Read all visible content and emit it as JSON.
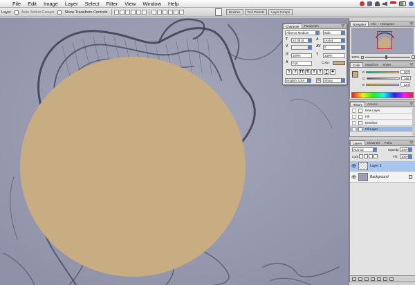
{
  "menubar": {
    "apple_icon": "apple-icon",
    "items": [
      "File",
      "Edit",
      "Image",
      "Layer",
      "Select",
      "Filter",
      "View",
      "Window",
      "Help"
    ]
  },
  "options_bar": {
    "tool_label": "Layer",
    "auto_select_groups": "Auto Select Groups",
    "show_transform_controls": "Show Transform Controls",
    "well_tabs": [
      "Brushes",
      "Tool Presets",
      "Layer Comps"
    ]
  },
  "character_panel": {
    "tabs": [
      "Character",
      "Paragraph"
    ],
    "font_family": "Alberus Medium",
    "font_style": "Italic",
    "font_size": "12.38 pt",
    "leading": "(Auto)",
    "kerning": "",
    "tracking": "0",
    "vertical_scale": "100%",
    "horizontal_scale": "100%",
    "baseline_shift": "0 pt",
    "color_label": "Color:",
    "style_buttons": [
      "T",
      "T",
      "TT",
      "Tt",
      "T",
      "T",
      "T",
      "T"
    ],
    "language": "English: USA",
    "antialias_label": "a",
    "antialias": "Sharp"
  },
  "navigator_panel": {
    "tabs": [
      "Navigator",
      "Info",
      "Histogram"
    ],
    "zoom": "100%"
  },
  "color_panel": {
    "tabs": [
      "Color",
      "Swatches",
      "Styles"
    ],
    "r_label": "R",
    "g_label": "G",
    "b_label": "B",
    "r": "207",
    "g": "169",
    "b": "124",
    "swatch_color": "#c7ad81"
  },
  "history_panel": {
    "tabs": [
      "History",
      "Actions"
    ],
    "items": [
      "New Layer",
      "Fill",
      "Deselect",
      "Fill Layer"
    ],
    "selected_index": 3
  },
  "layers_panel": {
    "tabs": [
      "Layers",
      "Channels",
      "Paths"
    ],
    "blend_mode": "Normal",
    "opacity_label": "Opacity:",
    "opacity": "100%",
    "lock_label": "Lock:",
    "fill_label": "Fill:",
    "fill": "100%",
    "layers": [
      {
        "name": "Layer 1",
        "selected": true
      },
      {
        "name": "Background",
        "selected": false
      }
    ]
  },
  "canvas": {
    "background_color": "#9d9fb4",
    "circle_color": "#c7ad81"
  },
  "ui_colors": {
    "selection_blue": "#a9c6f0",
    "panel_bg": "#e3e3e3",
    "nav_box_red": "#d62020"
  }
}
